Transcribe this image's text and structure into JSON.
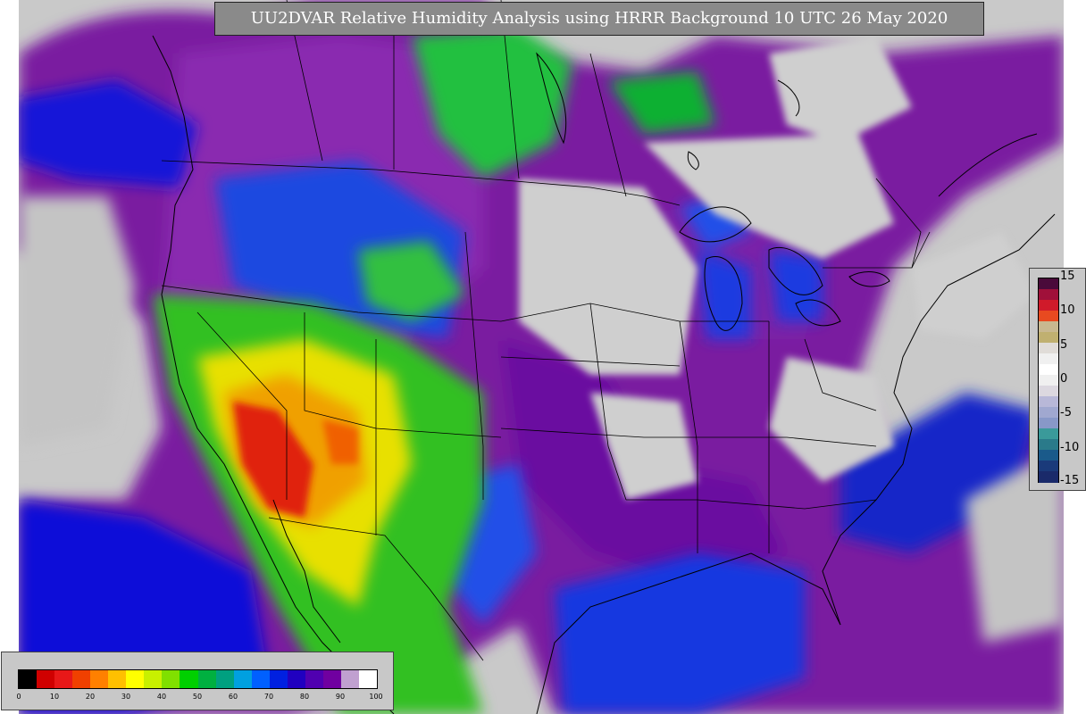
{
  "title": "UU2DVAR Relative Humidity Analysis using HRRR Background 10 UTC 26 May 2020",
  "map": {
    "projection": "conus-lambert",
    "background_color": "#c9c9c9",
    "humidity_fields": [
      "very-dry-red",
      "dry-orange-yellow",
      "mid-green",
      "moist-blue",
      "saturated-purple"
    ],
    "border_color": "#000000"
  },
  "right_colorbar": {
    "ticks": [
      "15",
      "10",
      "5",
      "0",
      "-5",
      "-10",
      "-15"
    ],
    "colors": [
      "#4a0a3a",
      "#a0103a",
      "#d01a2a",
      "#e84a20",
      "#c8b890",
      "#c0b070",
      "#e0dcd8",
      "#f0f0f0",
      "#ffffff",
      "#f0f0f0",
      "#dcd8e0",
      "#b8b8d8",
      "#a0a8d0",
      "#8898c8",
      "#3a9a9a",
      "#2a7a8a",
      "#1a5a8a",
      "#1a3a7a",
      "#1a2a6a"
    ]
  },
  "bottom_colorbar": {
    "ticks": [
      "0",
      "10",
      "20",
      "30",
      "40",
      "50",
      "60",
      "70",
      "80",
      "90",
      "100"
    ],
    "colors": [
      "#000000",
      "#d00000",
      "#e81818",
      "#f04000",
      "#ff8000",
      "#ffc000",
      "#ffff00",
      "#c8f000",
      "#80e000",
      "#00d000",
      "#00b040",
      "#00a080",
      "#00a0e0",
      "#0060ff",
      "#0020e0",
      "#2000c0",
      "#5000b0",
      "#7000a0",
      "#c0a0d0",
      "#ffffff"
    ]
  }
}
